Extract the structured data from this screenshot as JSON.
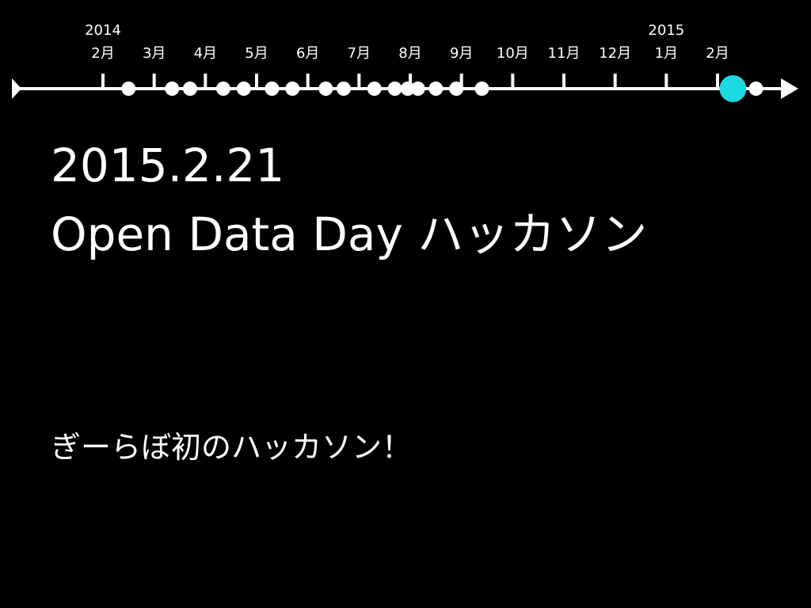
{
  "timeline": {
    "year_labels": [
      {
        "text": "2014",
        "month_index": 0
      },
      {
        "text": "2015",
        "month_index": 11
      }
    ],
    "months": [
      "2月",
      "3月",
      "4月",
      "5月",
      "6月",
      "7月",
      "8月",
      "9月",
      "10月",
      "11月",
      "12月",
      "1月",
      "2月"
    ],
    "events": [
      0.5,
      1.35,
      1.7,
      2.35,
      2.75,
      3.3,
      3.7,
      4.35,
      4.7,
      5.3,
      5.7,
      5.95,
      6.15,
      6.5,
      6.9,
      7.4
    ],
    "highlight_event": 12.3,
    "trailing_event": 12.75,
    "line_color": "#ffffff",
    "highlight_color": "#1cd8e0"
  },
  "slide": {
    "date": "2015.2.21",
    "title": "Open Data Day ハッカソン",
    "caption": "ぎーらぼ初のハッカソン！"
  }
}
